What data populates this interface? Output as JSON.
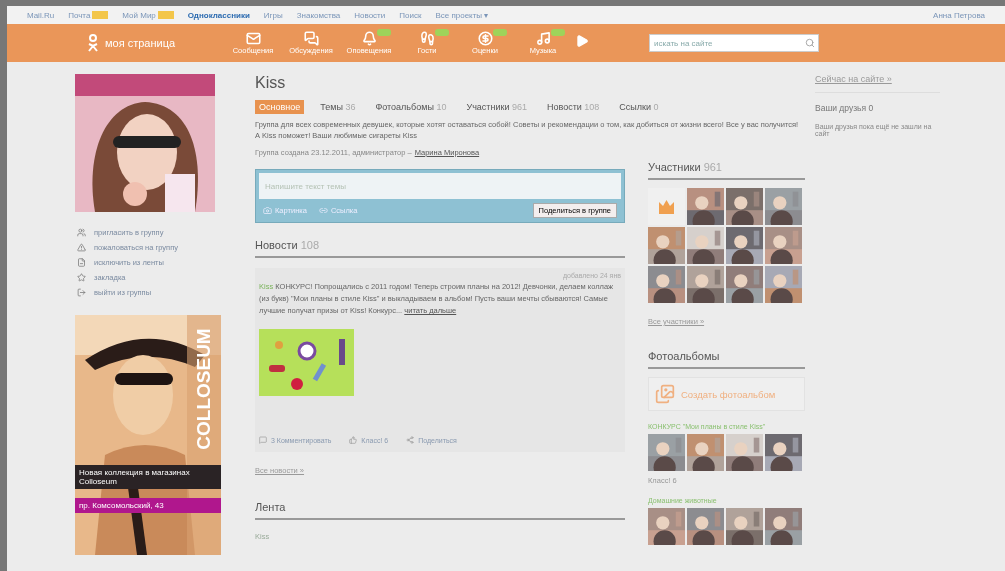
{
  "top_bar": {
    "links": [
      {
        "label": "Mail.Ru",
        "badge": false,
        "selected": false
      },
      {
        "label": "Почта",
        "badge": true,
        "selected": false
      },
      {
        "label": "Мой Мир",
        "badge": true,
        "selected": false
      },
      {
        "label": "Одноклассники",
        "badge": false,
        "selected": true
      },
      {
        "label": "Игры",
        "badge": false,
        "selected": false
      },
      {
        "label": "Знакомства",
        "badge": false,
        "selected": false
      },
      {
        "label": "Новости",
        "badge": false,
        "selected": false
      },
      {
        "label": "Поиск",
        "badge": false,
        "selected": false
      },
      {
        "label": "Все проекты ▾",
        "badge": false,
        "selected": false
      }
    ],
    "user": "Анна Петрова"
  },
  "nav": {
    "home": "моя страница",
    "items": [
      {
        "label": "Сообщения",
        "badge": false
      },
      {
        "label": "Обсуждения",
        "badge": false
      },
      {
        "label": "Оповещения",
        "badge": true
      },
      {
        "label": "Гости",
        "badge": true
      },
      {
        "label": "Оценки",
        "badge": true
      },
      {
        "label": "Музыка",
        "badge": true
      }
    ],
    "search": {
      "placeholder": "искать на сайте"
    }
  },
  "group_menu": [
    {
      "label": "пригласить в группу"
    },
    {
      "label": "пожаловаться на группу"
    },
    {
      "label": "исключить из ленты"
    },
    {
      "label": "закладка"
    },
    {
      "label": "выйти из группы"
    }
  ],
  "ad": {
    "brand": "COLLOSEUM",
    "caption": "Новая коллекция в магазинах Colloseum",
    "address": "пр. Комсомольский, 43"
  },
  "group": {
    "title": "Kiss",
    "tabs": [
      {
        "label": "Основное",
        "selected": true
      },
      {
        "label": "Темы",
        "count": "36",
        "selected": false
      },
      {
        "label": "Фотоальбомы",
        "count": "10",
        "selected": false
      },
      {
        "label": "Участники",
        "count": "961",
        "selected": false
      },
      {
        "label": "Новости",
        "count": "108",
        "selected": false
      },
      {
        "label": "Ссылки",
        "count": "0",
        "selected": false
      }
    ],
    "description": "Группа для всех современных девушек, которые хотят оставаться собой! Советы и рекомендации о том, как добиться от жизни всего! Все у вас получится! А Kiss поможет! Ваши любимые сигареты Kiss",
    "created": "Группа создана 23.12.2011, администратор –",
    "admin": "Марина Миронова"
  },
  "composer": {
    "placeholder": "Напишите текст темы",
    "photo": "Картинка",
    "link": "Ссылка",
    "submit": "Поделиться в группе"
  },
  "news": {
    "title": "Новости",
    "count": "108",
    "post": {
      "date": "добавлено 24 янв",
      "author": "Kiss",
      "text": "КОНКУРС! Попрощались с 2011 годом! Теперь строим планы на 2012! Девчонки, делаем коллаж (из букв) \"Мои планы в стиле Kiss\" и выкладываем в альбом! Пусть ваши мечты сбываются! Самые лучшие получат призы от Kiss! Конкурс...",
      "more": "читать дальше",
      "actions": [
        "3 Комментировать",
        "Класс! 6",
        "Поделиться"
      ]
    },
    "all": "Все новости »"
  },
  "feed": {
    "title": "Лента",
    "author": "Kiss"
  },
  "members": {
    "title": "Участники",
    "count": "961",
    "all": "Все участники »"
  },
  "albums": {
    "title": "Фотоальбомы",
    "create": "Создать фотоальбом",
    "list": [
      {
        "name": "КОНКУРС \"Мои планы в стиле Kiss\"",
        "likes": "Класс! 6"
      },
      {
        "name": "Домашние животные"
      }
    ]
  },
  "online": {
    "link": "Сейчас на сайте »",
    "friends": "Ваши друзья 0",
    "note": "Ваши друзья пока ещё не зашли на сайт"
  }
}
